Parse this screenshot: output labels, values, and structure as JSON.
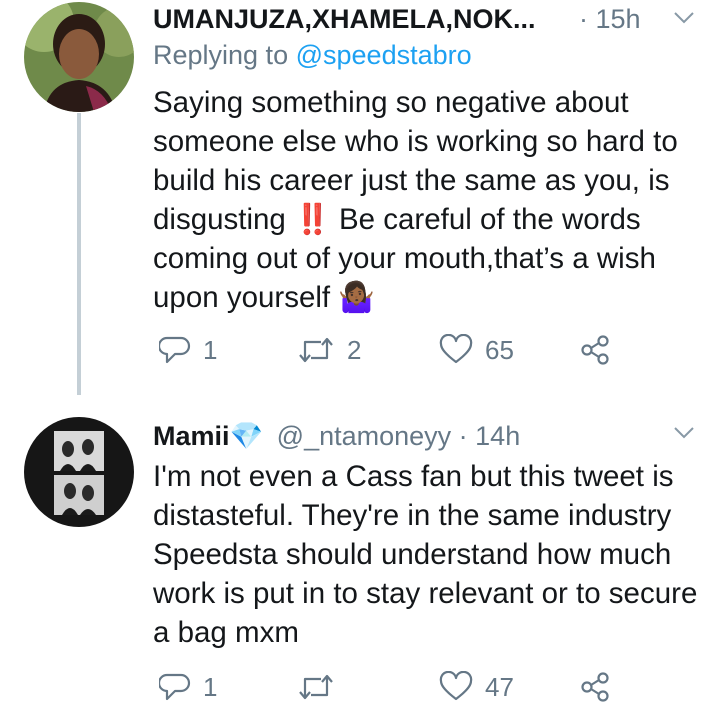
{
  "tweets": [
    {
      "display_name": "UMANJUZA,XHAMELA,NOK...",
      "time": "· 15h",
      "replying_label": "Replying to",
      "replying_to": "@speedstabro",
      "text": "Saying something so negative about someone else who is working so hard to build his career just the same as you, is disgusting ‼️ Be careful of the words coming out of your mouth,that’s a wish upon yourself 🤷🏾‍♀️",
      "reply_count": "1",
      "retweet_count": "2",
      "like_count": "65"
    },
    {
      "display_name": "Mamii💎",
      "handle": "@_ntamoneyy",
      "time": "· 14h",
      "text": "I'm not even a Cass fan but this tweet is distasteful. They're in the same industry Speedsta should understand how much work is put in to stay relevant or to secure a bag mxm",
      "reply_count": "1",
      "retweet_count": "",
      "like_count": "47"
    }
  ],
  "colors": {
    "text": "#14171a",
    "secondary": "#657786",
    "link": "#1da1f2",
    "thread_line": "#c4cfd6"
  },
  "icons": [
    "reply-icon",
    "retweet-icon",
    "like-icon",
    "share-icon",
    "chevron-down-icon"
  ]
}
